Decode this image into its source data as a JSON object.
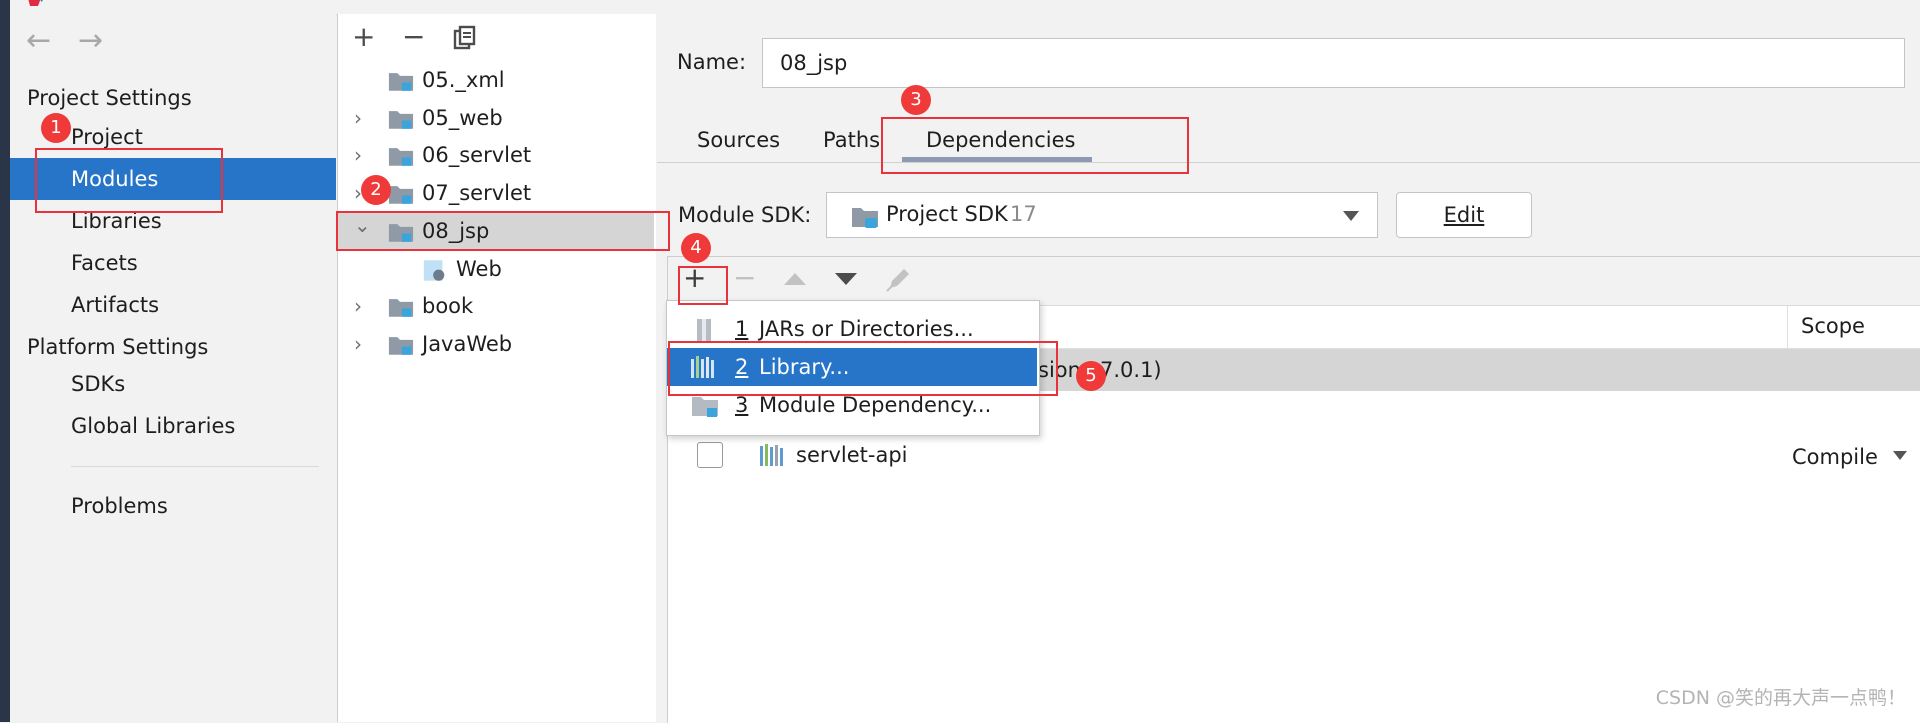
{
  "sidebar": {
    "nav_back": "←",
    "nav_forward": "→",
    "project_settings_header": "Project Settings",
    "project_items": [
      "Project",
      "Modules",
      "Libraries",
      "Facets",
      "Artifacts"
    ],
    "platform_settings_header": "Platform Settings",
    "platform_items": [
      "SDKs",
      "Global Libraries"
    ],
    "problems": "Problems",
    "selected": "Modules"
  },
  "module_tree": {
    "toolbar": {
      "add": "+",
      "remove": "−"
    },
    "items": [
      {
        "label": "05._xml",
        "expandable": false,
        "level": 0
      },
      {
        "label": "05_web",
        "expandable": true,
        "level": 0
      },
      {
        "label": "06_servlet",
        "expandable": true,
        "level": 0
      },
      {
        "label": "07_servlet",
        "expandable": true,
        "level": 0
      },
      {
        "label": "08_jsp",
        "expandable": true,
        "expanded": true,
        "level": 0,
        "selected": true
      },
      {
        "label": "Web",
        "expandable": false,
        "level": 1
      },
      {
        "label": "book",
        "expandable": true,
        "level": 0
      },
      {
        "label": "JavaWeb",
        "expandable": true,
        "level": 0
      }
    ]
  },
  "detail": {
    "name_label": "Name:",
    "name_value": "08_jsp",
    "tabs": [
      "Sources",
      "Paths",
      "Dependencies"
    ],
    "active_tab": "Dependencies",
    "module_sdk_label": "Module SDK:",
    "module_sdk_value": "Project SDK",
    "module_sdk_version": "17",
    "edit_button": "Edit",
    "deps_toolbar": {
      "add": "+",
      "remove": "−"
    },
    "scope_header": "Scope",
    "dependency_partial_text": "sion",
    "dependency_partial_version": "7.0.1)",
    "dependencies": [
      {
        "name": "servlet-api",
        "scope": "Compile",
        "checked": false
      }
    ]
  },
  "add_menu": {
    "items": [
      {
        "key": "1",
        "label": "JARs or Directories..."
      },
      {
        "key": "2",
        "label": "Library...",
        "selected": true
      },
      {
        "key": "3",
        "label": "Module Dependency..."
      }
    ]
  },
  "annotations": {
    "badges": [
      "1",
      "2",
      "3",
      "4",
      "5"
    ]
  },
  "watermark": "CSDN @笑的再大声一点鸭！",
  "colors": {
    "selection_blue": "#2775c9",
    "annotation_red": "#e8323c",
    "folder_gray": "#8f9aa6",
    "module_marker_blue": "#3aa5dd"
  }
}
